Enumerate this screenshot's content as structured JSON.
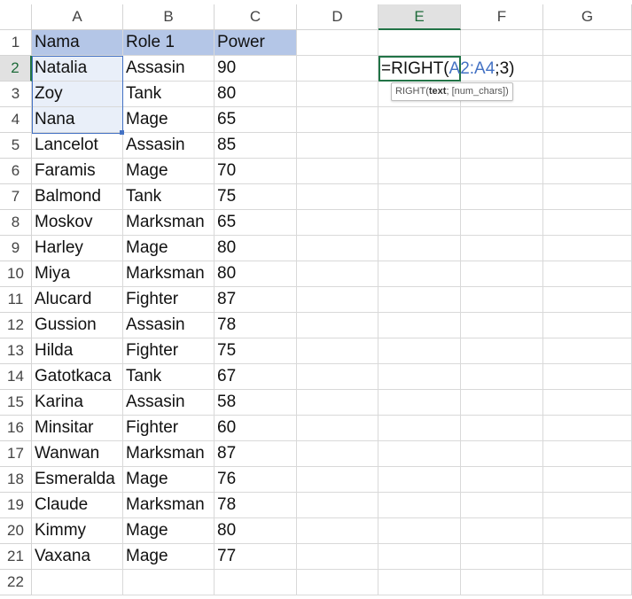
{
  "columns": [
    "A",
    "B",
    "C",
    "D",
    "E",
    "F",
    "G"
  ],
  "active_column": "E",
  "active_row": "2",
  "rows": [
    {
      "num": "1",
      "a": "Nama",
      "b": "Role 1",
      "c": "Power"
    },
    {
      "num": "2",
      "a": "Natalia",
      "b": "Assasin",
      "c": "90"
    },
    {
      "num": "3",
      "a": "Zoy",
      "b": "Tank",
      "c": "80"
    },
    {
      "num": "4",
      "a": "Nana",
      "b": "Mage",
      "c": "65"
    },
    {
      "num": "5",
      "a": "Lancelot",
      "b": "Assasin",
      "c": "85"
    },
    {
      "num": "6",
      "a": "Faramis",
      "b": "Mage",
      "c": "70"
    },
    {
      "num": "7",
      "a": "Balmond",
      "b": "Tank",
      "c": "75"
    },
    {
      "num": "8",
      "a": "Moskov",
      "b": "Marksman",
      "c": "65"
    },
    {
      "num": "9",
      "a": "Harley",
      "b": "Mage",
      "c": "80"
    },
    {
      "num": "10",
      "a": "Miya",
      "b": "Marksman",
      "c": "80"
    },
    {
      "num": "11",
      "a": "Alucard",
      "b": "Fighter",
      "c": "87"
    },
    {
      "num": "12",
      "a": "Gussion",
      "b": "Assasin",
      "c": "78"
    },
    {
      "num": "13",
      "a": "Hilda",
      "b": "Fighter",
      "c": "75"
    },
    {
      "num": "14",
      "a": "Gatotkaca",
      "b": "Tank",
      "c": "67"
    },
    {
      "num": "15",
      "a": "Karina",
      "b": "Assasin",
      "c": "58"
    },
    {
      "num": "16",
      "a": "Minsitar",
      "b": "Fighter",
      "c": "60"
    },
    {
      "num": "17",
      "a": "Wanwan",
      "b": "Marksman",
      "c": "87"
    },
    {
      "num": "18",
      "a": "Esmeralda",
      "b": "Mage",
      "c": "76"
    },
    {
      "num": "19",
      "a": "Claude",
      "b": "Marksman",
      "c": "78"
    },
    {
      "num": "20",
      "a": "Kimmy",
      "b": "Mage",
      "c": "80"
    },
    {
      "num": "21",
      "a": "Vaxana",
      "b": "Mage",
      "c": "77"
    },
    {
      "num": "22",
      "a": "",
      "b": "",
      "c": ""
    }
  ],
  "editing_cell": {
    "formula_prefix": "=RIGHT(",
    "formula_ref": "A2:A4",
    "formula_suffix": ";3)"
  },
  "tooltip": {
    "func": "RIGHT(",
    "arg_bold": "text",
    "rest": "; [num_chars])"
  },
  "colors": {
    "header_fill": "#b4c6e7",
    "reference_border": "#4472c4",
    "active_cell_border": "#217346"
  }
}
